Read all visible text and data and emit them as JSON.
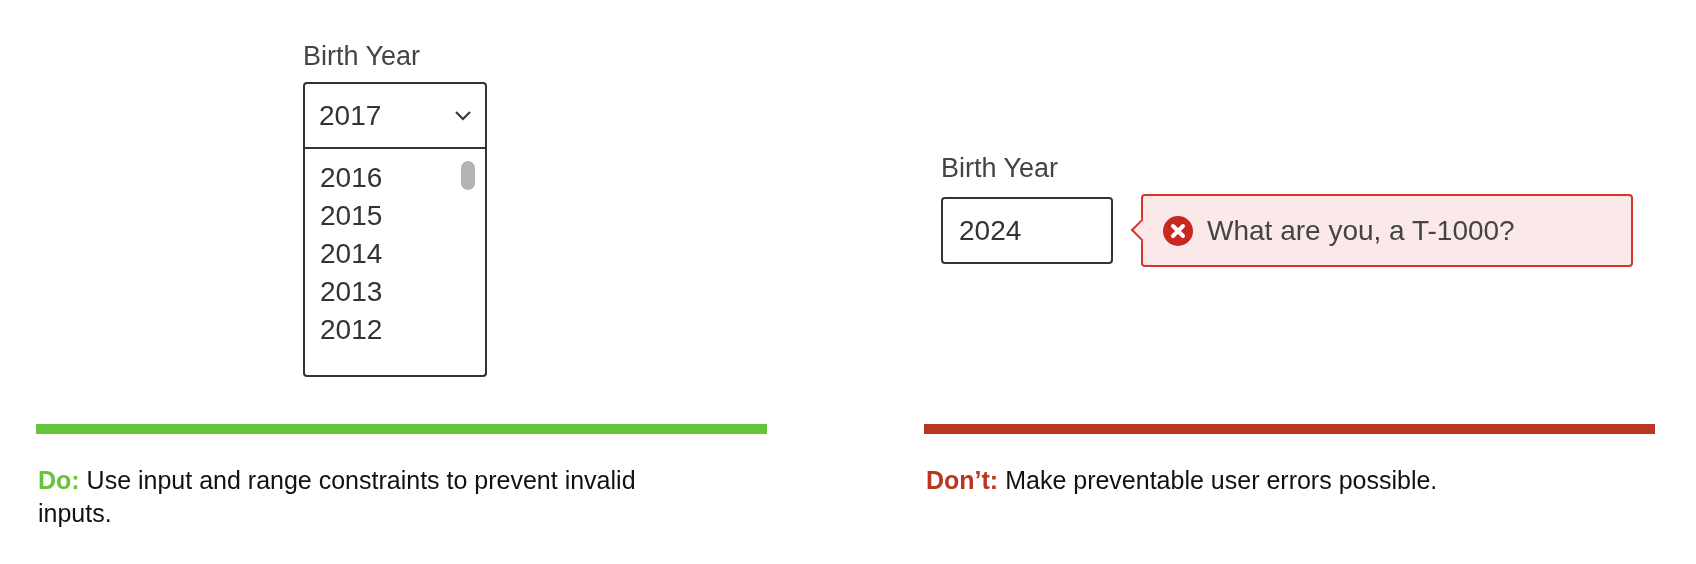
{
  "panels": [
    {
      "color": "#66c43a",
      "field": {
        "kind": "select",
        "label": "Birth Year",
        "value": "2017",
        "options": [
          "2016",
          "2015",
          "2014",
          "2013",
          "2012"
        ]
      },
      "caption": "**Do:** Use input and range constraints to prevent invalid inputs."
    },
    {
      "color": "#bb3620",
      "field": {
        "kind": "text",
        "label": "Birth Year",
        "value": "2024",
        "error": "What are you, a T-1000?"
      },
      "caption": "**Don’t:** Make preventable user errors possible."
    }
  ]
}
